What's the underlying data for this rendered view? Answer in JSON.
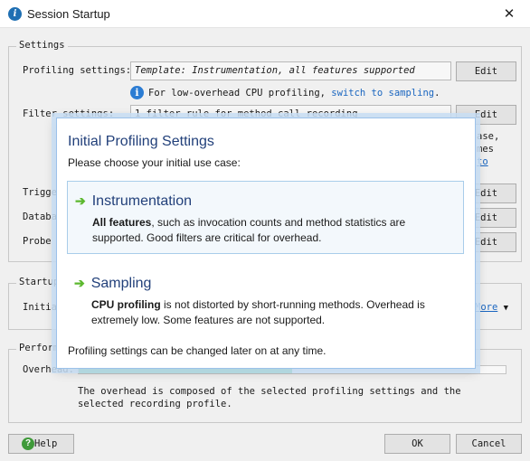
{
  "window": {
    "title": "Session Startup",
    "close_glyph": "✕",
    "app_icon": "i"
  },
  "settings": {
    "group_title": "Settings",
    "profiling_label": "Profiling settings:",
    "profiling_value": "Template: Instrumentation, all features supported",
    "edit_label": "Edit",
    "info_text": "For low-overhead CPU profiling,",
    "info_link": "switch to sampling",
    "info_period": ".",
    "filter_label": "Filter settings:",
    "filter_value": "1 filter rule for method call recording",
    "side_text_1": "ase,",
    "side_text_2": "mes",
    "side_text_3": "to",
    "trigger_label": "Trigge",
    "database_label": "Databa",
    "probe_label": "Probe"
  },
  "startup": {
    "group_title": "Startup",
    "initial_label": "Initia",
    "more_label": "More",
    "more_arrow": "▼"
  },
  "performance": {
    "group_title": "Perform",
    "overhead_label": "Overhead:",
    "overhead_fraction": 0.5,
    "description": "The overhead is composed of the selected profiling settings and the selected recording profile."
  },
  "footer": {
    "help_label": "Help",
    "help_icon": "?",
    "ok_label": "OK",
    "cancel_label": "Cancel"
  },
  "dialog": {
    "title": "Initial Profiling Settings",
    "subtitle": "Please choose your initial use case:",
    "options": [
      {
        "title": "Instrumentation",
        "bold": "All features",
        "rest": ", such as invocation counts and method statistics are supported. Good filters are critical for overhead."
      },
      {
        "title": "Sampling",
        "bold": "CPU profiling",
        "rest": " is not distorted by short-running methods. Overhead is extremely low. Some features are not supported."
      }
    ],
    "footer": "Profiling settings can be changed later on at any time.",
    "arrow_glyph": "➔"
  },
  "colors": {
    "accent": "#22407a",
    "arrow": "#5cb82e",
    "link": "#1a66c0",
    "progress": "#38c06a"
  }
}
